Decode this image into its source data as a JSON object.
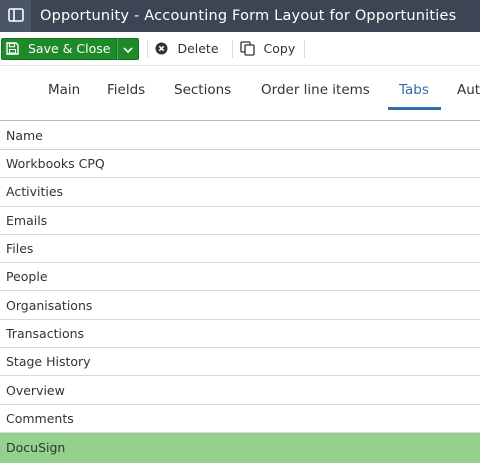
{
  "titlebar": {
    "panel_icon": "sidebar-panel-icon",
    "title": "Opportunity - Accounting Form Layout for Opportunities"
  },
  "toolbar": {
    "save_close_label": "Save & Close",
    "save_icon": "floppy-disk-icon",
    "dropdown_icon": "chevron-down-icon",
    "delete_label": "Delete",
    "delete_icon": "x-circle-icon",
    "copy_label": "Copy",
    "copy_icon": "copy-icon"
  },
  "tabs": [
    {
      "label": "Main"
    },
    {
      "label": "Fields"
    },
    {
      "label": "Sections"
    },
    {
      "label": "Order line items"
    },
    {
      "label": "Tabs"
    },
    {
      "label": "Aut"
    }
  ],
  "active_tab": "Tabs",
  "table": {
    "header": "Name",
    "rows": [
      "Workbooks CPQ",
      "Activities",
      "Emails",
      "Files",
      "People",
      "Organisations",
      "Transactions",
      "Stage History",
      "Overview",
      "Comments",
      "DocuSign"
    ],
    "selected_row": "DocuSign"
  },
  "colors": {
    "titlebar_bg": "#3b4553",
    "save_green": "#1e8a2a",
    "active_tab_blue": "#2f6fa8",
    "selected_row_green": "#94d18e"
  }
}
